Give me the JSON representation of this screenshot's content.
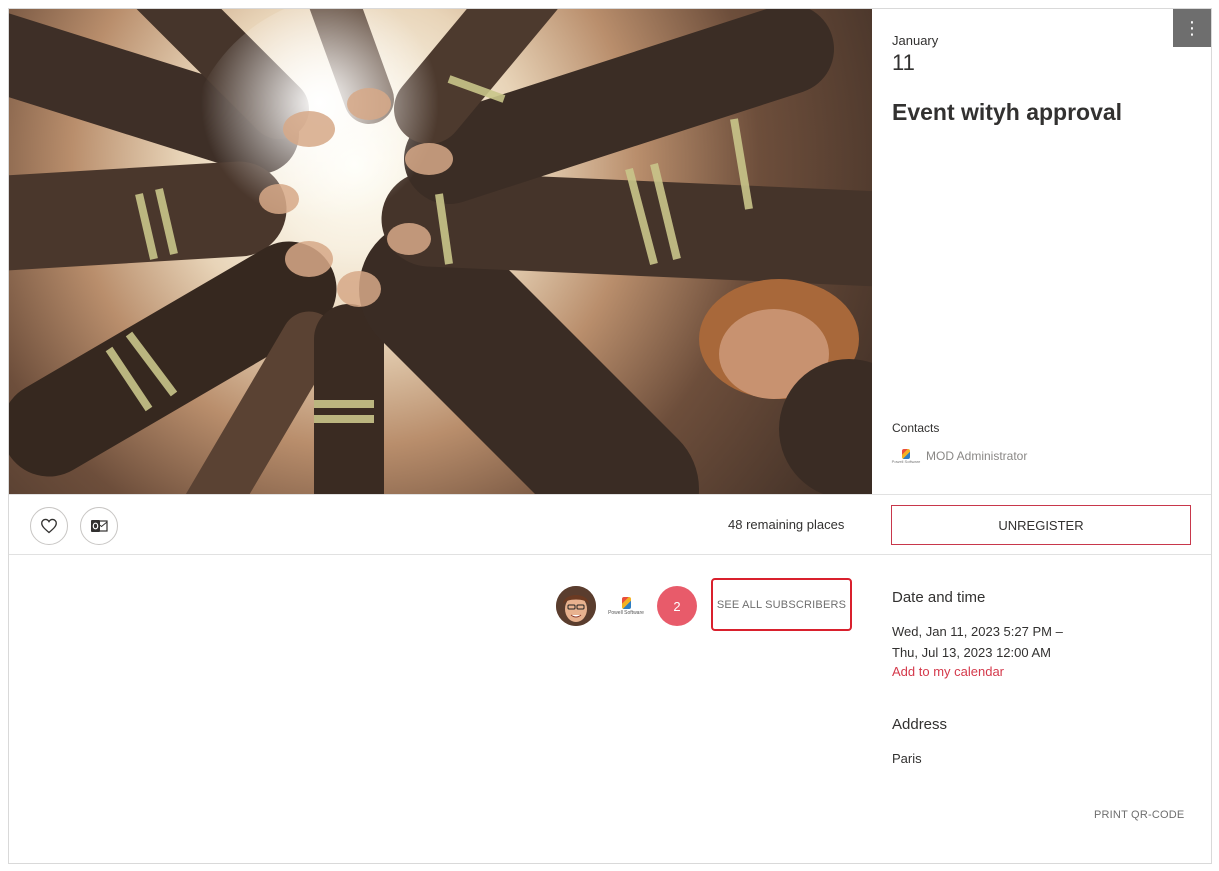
{
  "event": {
    "month": "January",
    "day": "11",
    "title": "Event wityh approval",
    "contacts_label": "Contacts",
    "contact_name": "MOD Administrator",
    "logo_text": "Powell Software"
  },
  "menu": {
    "more_icon": "more-vertical-icon",
    "more_glyph": "⋮"
  },
  "actions": {
    "like_icon": "heart-icon",
    "outlook_icon": "outlook-icon",
    "remaining_places": "48 remaining places",
    "unregister_label": "UNREGISTER"
  },
  "subscribers": {
    "count": "2",
    "see_all_label": "SEE ALL SUBSCRIBERS"
  },
  "details": {
    "date_time_heading": "Date and time",
    "date_line_1": "Wed, Jan 11, 2023 5:27 PM –",
    "date_line_2": "Thu, Jul 13, 2023 12:00 AM",
    "add_calendar_label": "Add to my calendar",
    "address_heading": "Address",
    "address_value": "Paris",
    "print_qr_label": "PRINT QR-CODE"
  },
  "colors": {
    "accent_red": "#d4394b",
    "badge_red": "#e85b6a",
    "menu_gray": "#6e6e6e"
  }
}
